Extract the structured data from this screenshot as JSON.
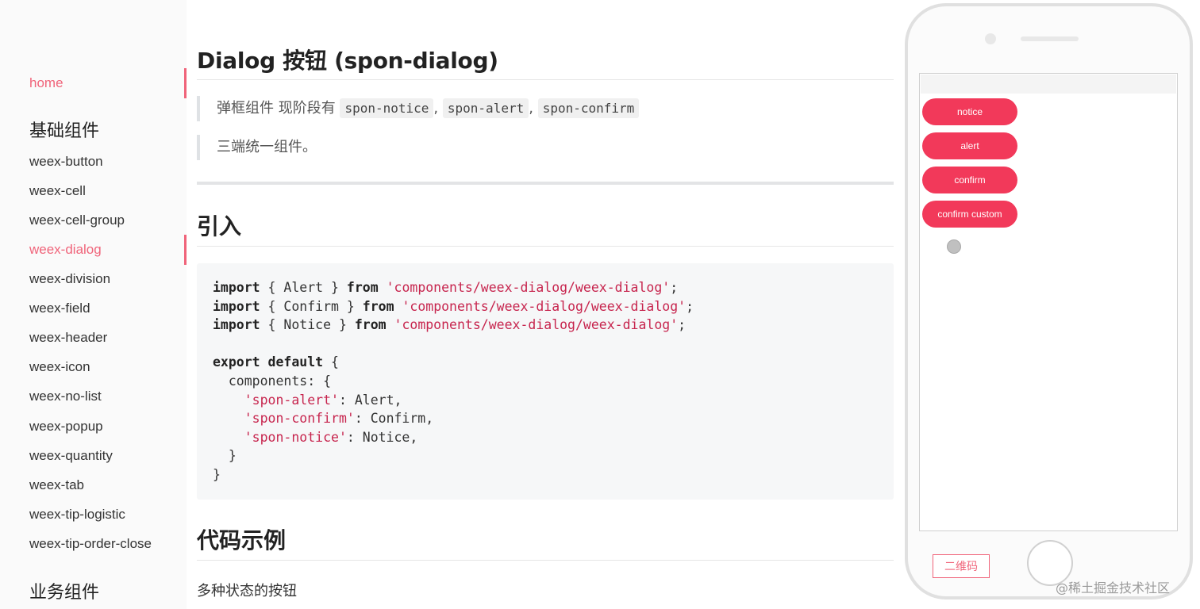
{
  "sidebar": {
    "home": "home",
    "group1_heading": "基础组件",
    "items": [
      "weex-button",
      "weex-cell",
      "weex-cell-group",
      "weex-dialog",
      "weex-division",
      "weex-field",
      "weex-header",
      "weex-icon",
      "weex-no-list",
      "weex-popup",
      "weex-quantity",
      "weex-tab",
      "weex-tip-logistic",
      "weex-tip-order-close"
    ],
    "group2_heading": "业务组件",
    "active_color": "#f0647a"
  },
  "main": {
    "title": "Dialog 按钮 (spon-dialog)",
    "quote1_prefix": "弹框组件 现阶段有 ",
    "quote1_codes": [
      "spon-notice",
      "spon-alert",
      "spon-confirm"
    ],
    "quote1_sep": ",",
    "quote2": "三端统一组件。",
    "section_import": "引入",
    "code": {
      "import_kw": "import",
      "from_kw": "from",
      "export_kw": "export default",
      "lines": [
        {
          "name": "{ Alert }",
          "path": "'components/weex-dialog/weex-dialog'"
        },
        {
          "name": "{ Confirm }",
          "path": "'components/weex-dialog/weex-dialog'"
        },
        {
          "name": "{ Notice }",
          "path": "'components/weex-dialog/weex-dialog'"
        }
      ],
      "components_key": "components: {",
      "entries": [
        {
          "key": "'spon-alert'",
          "value": ": Alert,"
        },
        {
          "key": "'spon-confirm'",
          "value": ": Confirm,"
        },
        {
          "key": "'spon-notice'",
          "value": ": Notice,"
        }
      ]
    },
    "section_example": "代码示例",
    "example_text": "多种状态的按钮"
  },
  "phone": {
    "buttons": [
      "notice",
      "alert",
      "confirm",
      "confirm custom"
    ],
    "qr_label": "二维码",
    "button_color": "#f2395a"
  },
  "watermark": "@稀土掘金技术社区"
}
